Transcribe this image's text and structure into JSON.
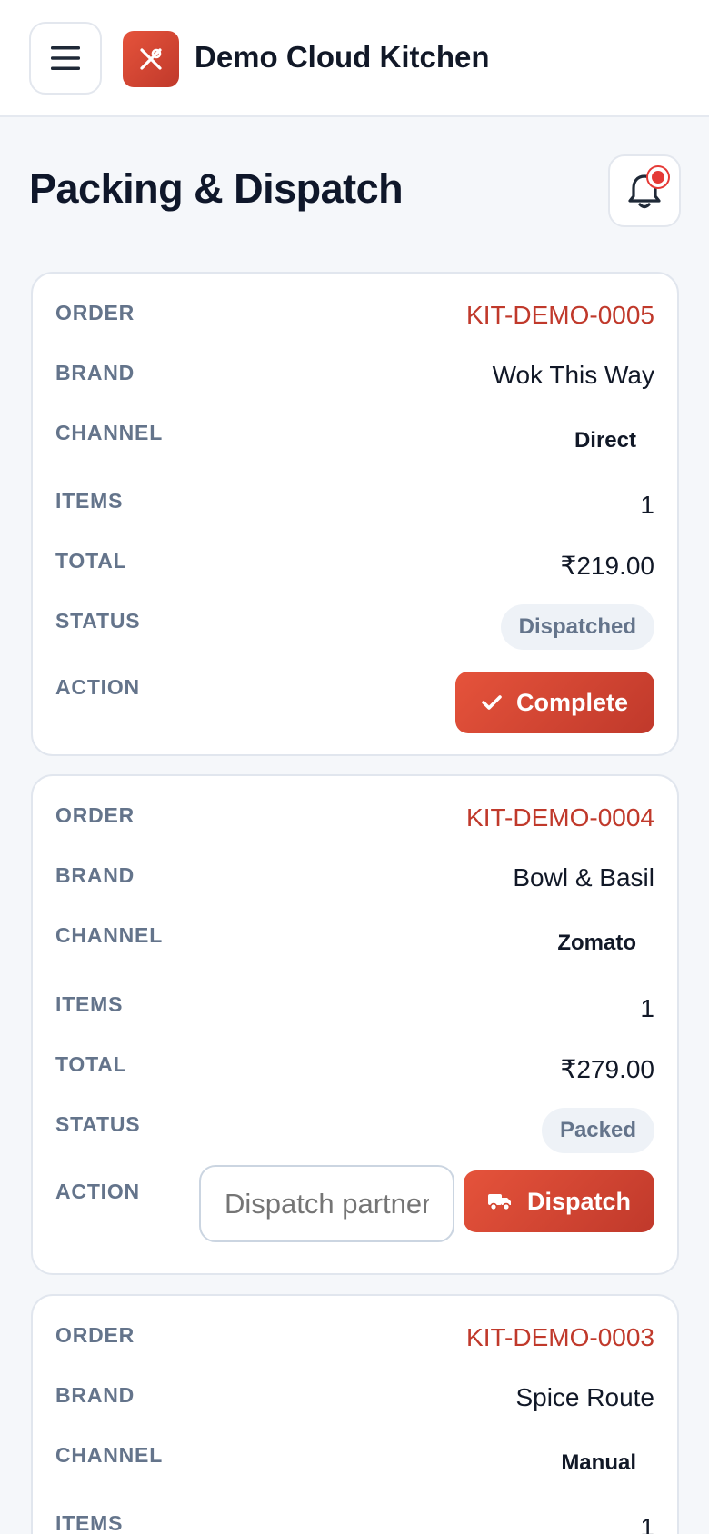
{
  "header": {
    "app_title": "Demo Cloud Kitchen",
    "page_title": "Packing & Dispatch"
  },
  "labels": {
    "order": "ORDER",
    "brand": "BRAND",
    "channel": "CHANNEL",
    "items": "ITEMS",
    "total": "TOTAL",
    "status": "STATUS",
    "action": "ACTION"
  },
  "orders": [
    {
      "order_id": "KIT-DEMO-0005",
      "brand": "Wok This Way",
      "channel": "Direct",
      "items": "1",
      "total": "₹219.00",
      "status": "Dispatched",
      "action_label": "Complete",
      "action_icon": "check-icon"
    },
    {
      "order_id": "KIT-DEMO-0004",
      "brand": "Bowl & Basil",
      "channel": "Zomato",
      "items": "1",
      "total": "₹279.00",
      "status": "Packed",
      "action_label": "Dispatch",
      "action_icon": "truck-icon",
      "dispatch_placeholder": "Dispatch partner"
    },
    {
      "order_id": "KIT-DEMO-0003",
      "brand": "Spice Route",
      "channel": "Manual",
      "items": "1"
    }
  ],
  "colors": {
    "accent": "#c0392b",
    "accent_light": "#e5533b",
    "label": "#64748b",
    "badge_bg": "#eef2f7"
  }
}
